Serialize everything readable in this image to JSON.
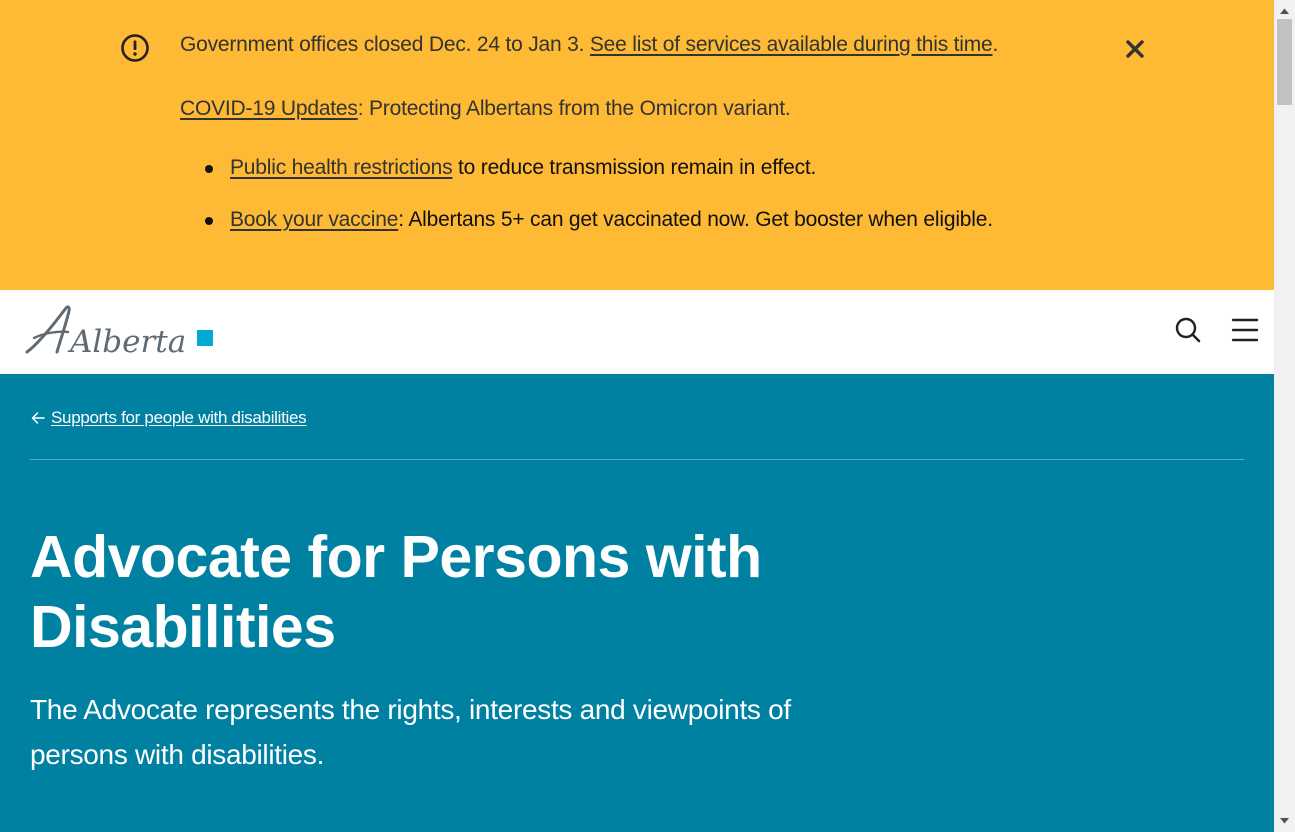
{
  "alert": {
    "icon": "exclamation-circle-icon",
    "close_icon": "close-icon",
    "line1_text": "Government offices closed Dec. 24 to Jan 3. ",
    "line1_link": "See list of services available during this time",
    "line1_end": ".",
    "line2_link": "COVID-19 Updates",
    "line2_text": ": Protecting Albertans from the Omicron variant.",
    "items": [
      {
        "link": "Public health restrictions",
        "text": " to reduce transmission remain in effect."
      },
      {
        "link": "Book your vaccine",
        "text": ": Albertans 5+ can get vaccinated now. Get booster when eligible."
      }
    ]
  },
  "header": {
    "logo_text": "Alberta",
    "search_icon": "search-icon",
    "menu_icon": "hamburger-menu-icon"
  },
  "hero": {
    "breadcrumb_icon": "arrow-left-icon",
    "breadcrumb_label": "Supports for people with disabilities",
    "title": "Advocate for Persons with Disabilities",
    "lead": "The Advocate represents the rights, interests and viewpoints of persons with disabilities."
  },
  "colors": {
    "alert_bg": "#feba35",
    "hero_bg": "#0081a2",
    "logo_gray": "#5f6a72",
    "logo_accent": "#00aad2"
  }
}
